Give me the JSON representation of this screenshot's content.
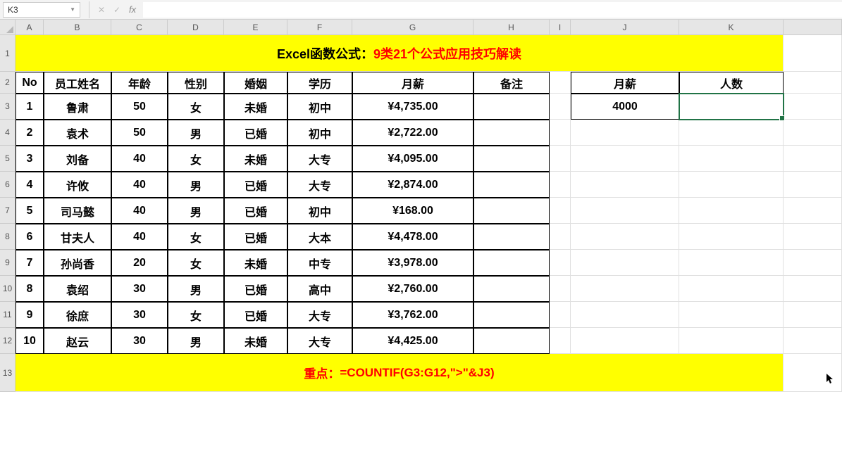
{
  "formulaBar": {
    "cellRef": "K3",
    "formula": ""
  },
  "columns": [
    "A",
    "B",
    "C",
    "D",
    "E",
    "F",
    "G",
    "H",
    "I",
    "J",
    "K"
  ],
  "rows": [
    "1",
    "2",
    "3",
    "4",
    "5",
    "6",
    "7",
    "8",
    "9",
    "10",
    "11",
    "12",
    "13"
  ],
  "title": {
    "prefix": "Excel函数公式：",
    "main": "9类21个公式应用技巧解读"
  },
  "headers": {
    "no": "No",
    "name": "员工姓名",
    "age": "年龄",
    "gender": "性别",
    "marital": "婚姻",
    "edu": "学历",
    "salary": "月薪",
    "remark": "备注",
    "salaryJ": "月薪",
    "countK": "人数"
  },
  "data": [
    {
      "no": "1",
      "name": "鲁肃",
      "age": "50",
      "gender": "女",
      "marital": "未婚",
      "edu": "初中",
      "salary": "¥4,735.00"
    },
    {
      "no": "2",
      "name": "袁术",
      "age": "50",
      "gender": "男",
      "marital": "已婚",
      "edu": "初中",
      "salary": "¥2,722.00"
    },
    {
      "no": "3",
      "name": "刘备",
      "age": "40",
      "gender": "女",
      "marital": "未婚",
      "edu": "大专",
      "salary": "¥4,095.00"
    },
    {
      "no": "4",
      "name": "许攸",
      "age": "40",
      "gender": "男",
      "marital": "已婚",
      "edu": "大专",
      "salary": "¥2,874.00"
    },
    {
      "no": "5",
      "name": "司马懿",
      "age": "40",
      "gender": "男",
      "marital": "已婚",
      "edu": "初中",
      "salary": "¥168.00"
    },
    {
      "no": "6",
      "name": "甘夫人",
      "age": "40",
      "gender": "女",
      "marital": "已婚",
      "edu": "大本",
      "salary": "¥4,478.00"
    },
    {
      "no": "7",
      "name": "孙尚香",
      "age": "20",
      "gender": "女",
      "marital": "未婚",
      "edu": "中专",
      "salary": "¥3,978.00"
    },
    {
      "no": "8",
      "name": "袁绍",
      "age": "30",
      "gender": "男",
      "marital": "已婚",
      "edu": "高中",
      "salary": "¥2,760.00"
    },
    {
      "no": "9",
      "name": "徐庶",
      "age": "30",
      "gender": "女",
      "marital": "已婚",
      "edu": "大专",
      "salary": "¥3,762.00"
    },
    {
      "no": "10",
      "name": "赵云",
      "age": "30",
      "gender": "男",
      "marital": "未婚",
      "edu": "大专",
      "salary": "¥4,425.00"
    }
  ],
  "side": {
    "j3": "4000",
    "k3": ""
  },
  "footer": {
    "prefix": "重点：",
    "formula": "=COUNTIF(G3:G12,\">\"&J3)"
  }
}
